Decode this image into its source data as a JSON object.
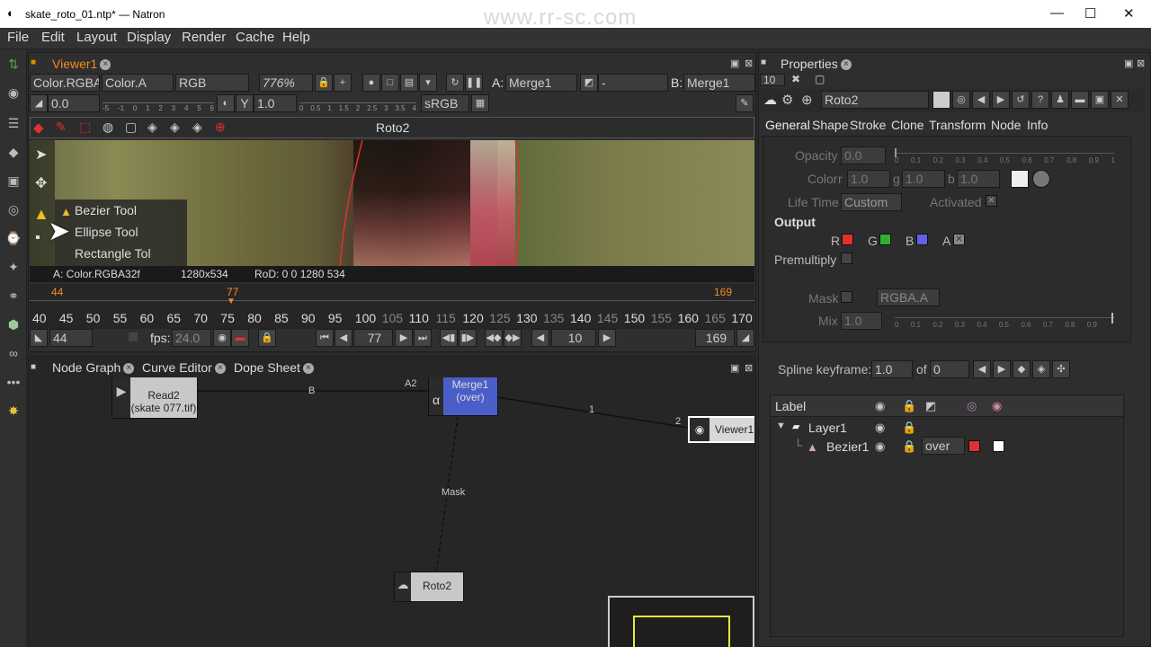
{
  "window": {
    "title": "skate_roto_01.ntp* — Natron",
    "watermark": "www.rr-sc.com",
    "min": "—",
    "max": "☐",
    "close": "✕"
  },
  "menu": [
    "File",
    "Edit",
    "Layout",
    "Display",
    "Render",
    "Cache",
    "Help"
  ],
  "viewer": {
    "tab": "Viewer1",
    "layer": "Color.RGBA",
    "alpha": "Color.A",
    "channels": "RGB",
    "zoom": "776%",
    "A_label": "A:",
    "A_input": "Merge1",
    "B_label": "B:",
    "B_input": "Merge1",
    "op": "-",
    "gain": "0.0",
    "gamma_label": "Y",
    "gamma": "1.0",
    "colorspace": "sRGB",
    "gain_ticks": [
      "-5",
      "-1",
      "0",
      "1",
      "2",
      "3",
      "4",
      "5",
      "6"
    ],
    "gamma_ticks": [
      "0",
      "0.5",
      "1",
      "1.5",
      "2",
      "2.5",
      "3",
      "3.5",
      "4"
    ],
    "roto_header": "Roto2",
    "info_left": "A: Color.RGBA32f",
    "info_res": "1280x534",
    "info_rod": "RoD: 0 0 1280 534",
    "context_menu": [
      "Bezier Tool",
      "Ellipse Tool",
      "Rectangle Tol"
    ]
  },
  "timeline": {
    "in_marker": "44",
    "current_marker": "77",
    "out_marker": "169",
    "ticks": [
      "40",
      "45",
      "50",
      "55",
      "60",
      "65",
      "70",
      "75",
      "80",
      "85",
      "90",
      "95",
      "100",
      "105",
      "110",
      "115",
      "120",
      "125",
      "130",
      "135",
      "140",
      "145",
      "150",
      "155",
      "160",
      "165",
      "170"
    ],
    "start": "44",
    "fps_label": "fps:",
    "fps": "24.0",
    "current": "77",
    "step": "10",
    "end": "169"
  },
  "nodegraph": {
    "tabs": [
      "Node Graph",
      "Curve Editor",
      "Dope Sheet"
    ],
    "read_label": "Read2",
    "read_file": "(skate 077.tif)",
    "merge_label": "Merge1",
    "merge_op": "(over)",
    "viewer_node": "Viewer1",
    "roto_node": "Roto2",
    "edge_b": "B",
    "edge_a2": "A2",
    "edge_1": "1",
    "edge_2": "2",
    "edge_mask": "Mask",
    "alpha_sym": "α"
  },
  "properties": {
    "tab": "Properties",
    "max_panels": "10",
    "node_name": "Roto2",
    "tabs": [
      "General",
      "Shape",
      "Stroke",
      "Clone",
      "Transform",
      "Node",
      "Info"
    ],
    "opacity_label": "Opacity",
    "opacity": "0.0",
    "opacity_ticks": [
      "0",
      "0.1",
      "0.2",
      "0.3",
      "0.4",
      "0.5",
      "0.6",
      "0.7",
      "0.8",
      "0.9",
      "1"
    ],
    "color_label": "Color",
    "r_label": "r",
    "g_label": "g",
    "b_label": "b",
    "color_r": "1.0",
    "color_g": "1.0",
    "color_b": "1.0",
    "lifetime_label": "Life Time",
    "lifetime": "Custom",
    "activated_label": "Activated",
    "output_label": "Output",
    "ch_r": "R",
    "ch_g": "G",
    "ch_b": "B",
    "ch_a": "A",
    "premult_label": "Premultiply",
    "mask_label": "Mask",
    "mask_ch": "RGBA.A",
    "mix_label": "Mix",
    "mix": "1.0",
    "mix_ticks": [
      "0",
      "0.1",
      "0.2",
      "0.3",
      "0.4",
      "0.5",
      "0.6",
      "0.7",
      "0.8",
      "0.9"
    ],
    "spline_label": "Spline keyframe:",
    "spline_val": "1.0",
    "of_label": "of",
    "of_val": "0",
    "tree_header": "Label",
    "layer": "Layer1",
    "bezier": "Bezier1",
    "bezier_op": "over"
  },
  "colors": {
    "accent": "#f08a24",
    "merge": "#4a5ec8",
    "viewer_border": "#ffffff",
    "preview_border": "#e8e83a"
  }
}
